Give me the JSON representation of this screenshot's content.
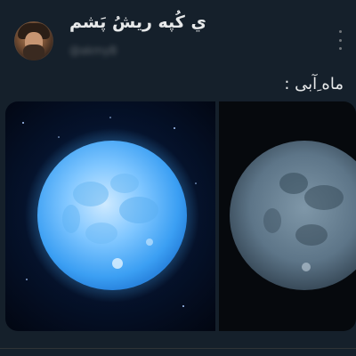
{
  "tweet": {
    "display_name": "ﻱ کُپه ریشُ پَشم",
    "handle": "@akmyB",
    "text": "ماه ِآبی :"
  },
  "icons": {
    "more": "more-vertical-icon",
    "avatar": "profile-avatar"
  },
  "colors": {
    "background": "#15202b",
    "text_primary": "#e7e9ea",
    "text_secondary": "#71767b"
  }
}
